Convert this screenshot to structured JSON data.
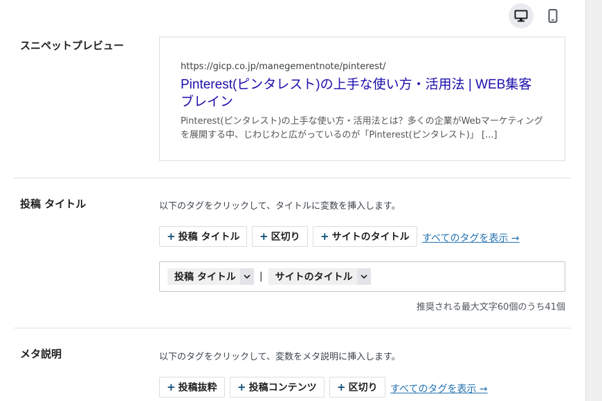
{
  "device_toggle": {
    "desktop_icon": "desktop-icon",
    "mobile_icon": "mobile-icon",
    "active": "desktop"
  },
  "snippet": {
    "label": "スニペットプレビュー",
    "url": "https://gicp.co.jp/manegementnote/pinterest/",
    "title": "Pinterest(ピンタレスト)の上手な使い方・活用法 | WEB集客ブレイン",
    "description": "Pinterest(ピンタレスト)の上手な使い方・活用法とは？多くの企業がWebマーケティングを展開する中、じわじわと広がっているのが「Pinterest(ピンタレスト)」 [...]"
  },
  "post_title": {
    "label": "投稿 タイトル",
    "help": "以下のタグをクリックして、タイトルに変数を挿入します。",
    "tags": [
      "投稿 タイトル",
      "区切り",
      "サイトのタイトル"
    ],
    "show_all": "すべてのタグを表示 →",
    "chips": [
      "投稿 タイトル",
      "サイトのタイトル"
    ],
    "separator": "|",
    "counter": "推奨される最大文字60個のうち41個"
  },
  "meta_desc": {
    "label": "メタ説明",
    "help": "以下のタグをクリックして、変数をメタ説明に挿入します。",
    "tags": [
      "投稿抜粋",
      "投稿コンテンツ",
      "区切り"
    ],
    "show_all": "すべてのタグを表示 →"
  },
  "colors": {
    "link": "#2271b1",
    "serp_title": "#1a0dab",
    "plus": "#0a4b78"
  }
}
